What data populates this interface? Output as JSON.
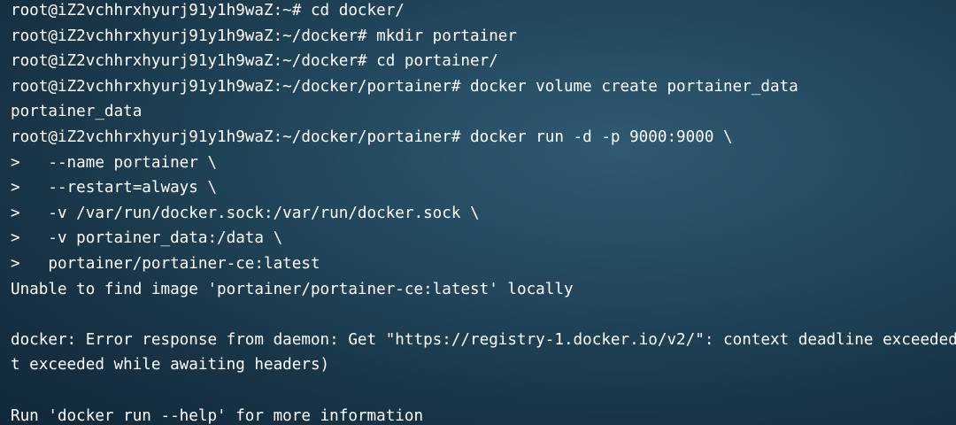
{
  "terminal": {
    "lines": [
      "root@iZ2vchhrxhyurj91y1h9waZ:~# cd docker/",
      "root@iZ2vchhrxhyurj91y1h9waZ:~/docker# mkdir portainer",
      "root@iZ2vchhrxhyurj91y1h9waZ:~/docker# cd portainer/",
      "root@iZ2vchhrxhyurj91y1h9waZ:~/docker/portainer# docker volume create portainer_data",
      "portainer_data",
      "root@iZ2vchhrxhyurj91y1h9waZ:~/docker/portainer# docker run -d -p 9000:9000 \\",
      ">   --name portainer \\",
      ">   --restart=always \\",
      ">   -v /var/run/docker.sock:/var/run/docker.sock \\",
      ">   -v portainer_data:/data \\",
      ">   portainer/portainer-ce:latest",
      "Unable to find image 'portainer/portainer-ce:latest' locally",
      "",
      "docker: Error response from daemon: Get \"https://registry-1.docker.io/v2/\": context deadline exceeded",
      "t exceeded while awaiting headers)",
      "",
      "Run 'docker run --help' for more information"
    ]
  }
}
